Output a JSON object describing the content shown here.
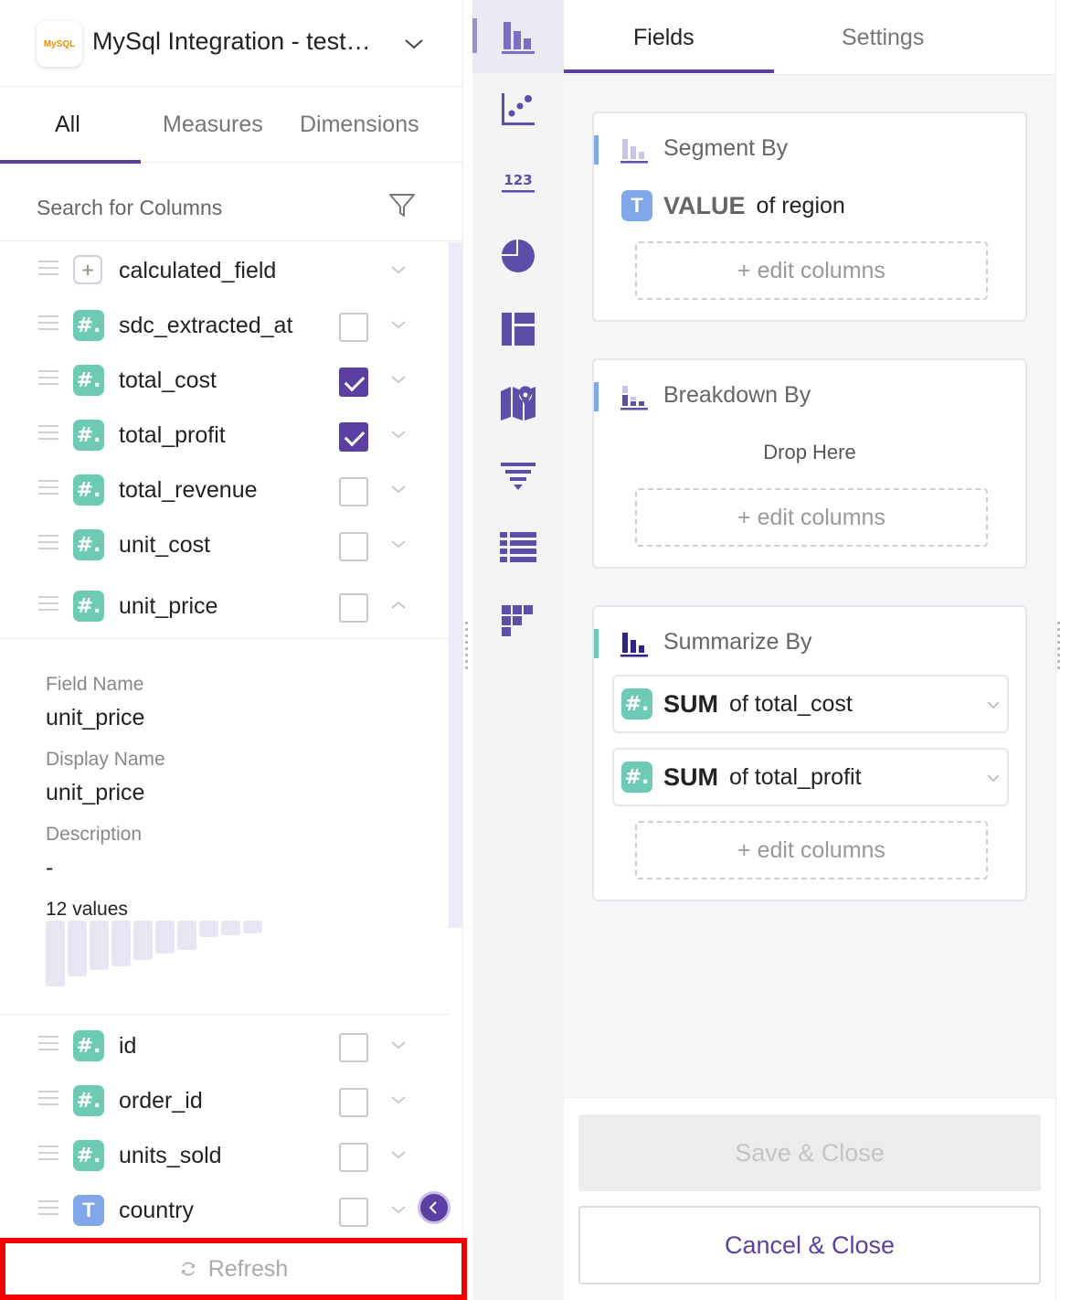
{
  "source": {
    "logo_text": "MySQL",
    "title": "MySql Integration - test…"
  },
  "left_tabs": [
    "All",
    "Measures",
    "Dimensions"
  ],
  "search": {
    "placeholder": "Search for Columns"
  },
  "fields": [
    {
      "name": "calculated_field",
      "type": "calc",
      "checked": null,
      "expanded": false
    },
    {
      "name": "sdc_extracted_at",
      "type": "num",
      "checked": false,
      "expanded": false
    },
    {
      "name": "total_cost",
      "type": "num",
      "checked": true,
      "expanded": false
    },
    {
      "name": "total_profit",
      "type": "num",
      "checked": true,
      "expanded": false
    },
    {
      "name": "total_revenue",
      "type": "num",
      "checked": false,
      "expanded": false
    },
    {
      "name": "unit_cost",
      "type": "num",
      "checked": false,
      "expanded": false
    },
    {
      "name": "unit_price",
      "type": "num",
      "checked": false,
      "expanded": true
    }
  ],
  "detail": {
    "field_name_label": "Field Name",
    "field_name": "unit_price",
    "display_name_label": "Display Name",
    "display_name": "unit_price",
    "description_label": "Description",
    "description": "-",
    "values_count": "12 values",
    "histogram": [
      1.0,
      0.85,
      0.75,
      0.7,
      0.6,
      0.5,
      0.45,
      0.25,
      0.22,
      0.2
    ]
  },
  "fields_more": [
    {
      "name": "id",
      "type": "num",
      "checked": false
    },
    {
      "name": "order_id",
      "type": "num",
      "checked": false
    },
    {
      "name": "units_sold",
      "type": "num",
      "checked": false
    },
    {
      "name": "country",
      "type": "txt",
      "checked": false
    }
  ],
  "refresh_label": "Refresh",
  "viz_icons": [
    "bar-chart-icon",
    "scatter-icon",
    "number-icon",
    "pie-chart-icon",
    "layout-icon",
    "map-icon",
    "funnel-icon",
    "table-icon",
    "heatmap-icon"
  ],
  "number_icon_text": "123",
  "right_tabs": [
    "Fields",
    "Settings"
  ],
  "segment": {
    "title": "Segment By",
    "item_type": "T",
    "item_agg": "VALUE",
    "item_rest": "of region",
    "edit": "+ edit columns"
  },
  "breakdown": {
    "title": "Breakdown By",
    "drop": "Drop Here",
    "edit": "+ edit columns"
  },
  "summarize": {
    "title": "Summarize By",
    "items": [
      {
        "agg": "SUM",
        "rest": "of total_cost"
      },
      {
        "agg": "SUM",
        "rest": "of total_profit"
      }
    ],
    "edit": "+ edit columns"
  },
  "footer": {
    "save": "Save & Close",
    "cancel": "Cancel & Close"
  },
  "colors": {
    "accent": "#5b3fa3",
    "numeric": "#6ccbb2",
    "text": "#7fa7ea",
    "highlight": "#f40000"
  }
}
